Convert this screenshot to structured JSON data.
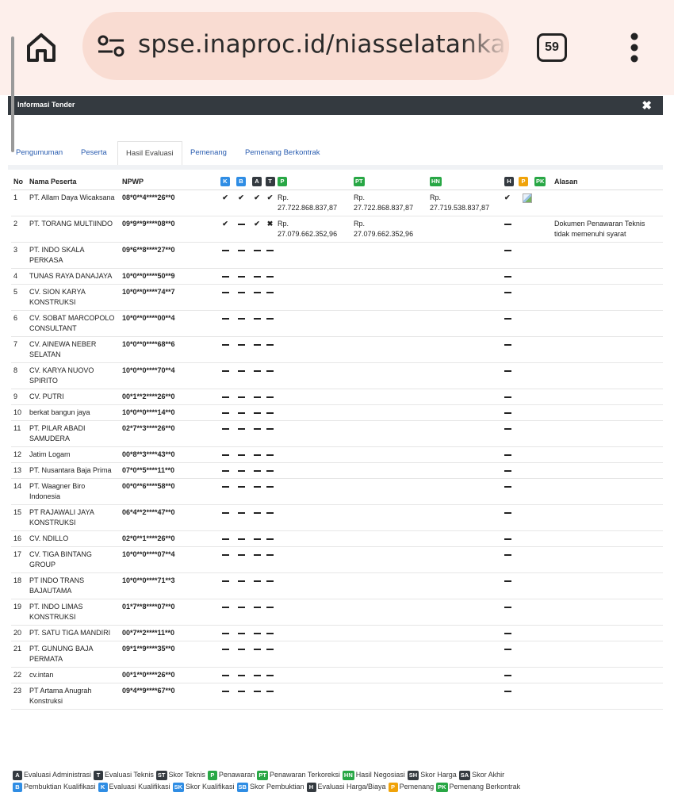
{
  "browser": {
    "url": "spse.inaproc.id/niasselatanka",
    "tab_count": "59"
  },
  "modal": {
    "title": "Informasi Tender",
    "close_label": "✖"
  },
  "tabs": [
    {
      "label": "Pengumuman",
      "active": false
    },
    {
      "label": "Peserta",
      "active": false
    },
    {
      "label": "Hasil Evaluasi",
      "active": true
    },
    {
      "label": "Pemenang",
      "active": false
    },
    {
      "label": "Pemenang Berkontrak",
      "active": false
    }
  ],
  "table": {
    "headers": {
      "no": "No",
      "name": "Nama Peserta",
      "npwp": "NPWP",
      "k": "K",
      "b": "B",
      "a": "A",
      "t": "T",
      "p": "P",
      "pt": "PT",
      "hn": "HN",
      "h": "H",
      "p2": "P",
      "pk": "PK",
      "alasan": "Alasan"
    },
    "rows": [
      {
        "no": "1",
        "name": "PT. Allam Daya Wicaksana",
        "npwp": "08*0**4****26**0",
        "k": "check",
        "b": "check",
        "a": "check",
        "t": "check",
        "p": "Rp. 27.722.868.837,87",
        "pt": "Rp. 27.722.868.837,87",
        "hn": "Rp. 27.719.538.837,87",
        "h": "check",
        "p2": "img",
        "pk": "",
        "alasan": ""
      },
      {
        "no": "2",
        "name": "PT. TORANG MULTIINDO",
        "npwp": "09*9**9****08**0",
        "k": "check",
        "b": "dash",
        "a": "check",
        "t": "cross",
        "p": "Rp. 27.079.662.352,96",
        "pt": "Rp. 27.079.662.352,96",
        "hn": "",
        "h": "dash",
        "p2": "",
        "pk": "",
        "alasan": "Dokumen Penawaran Teknis tidak memenuhi syarat"
      },
      {
        "no": "3",
        "name": "PT. INDO SKALA PERKASA",
        "npwp": "09*6**8****27**0",
        "k": "dash",
        "b": "dash",
        "a": "dash",
        "t": "dash",
        "p": "",
        "pt": "",
        "hn": "",
        "h": "dash",
        "p2": "",
        "pk": "",
        "alasan": ""
      },
      {
        "no": "4",
        "name": "TUNAS RAYA DANAJAYA",
        "npwp": "10*0**0****50**9",
        "k": "dash",
        "b": "dash",
        "a": "dash",
        "t": "dash",
        "p": "",
        "pt": "",
        "hn": "",
        "h": "dash",
        "p2": "",
        "pk": "",
        "alasan": ""
      },
      {
        "no": "5",
        "name": "CV. SION KARYA KONSTRUKSI",
        "npwp": "10*0**0****74**7",
        "k": "dash",
        "b": "dash",
        "a": "dash",
        "t": "dash",
        "p": "",
        "pt": "",
        "hn": "",
        "h": "dash",
        "p2": "",
        "pk": "",
        "alasan": ""
      },
      {
        "no": "6",
        "name": "CV. SOBAT MARCOPOLO CONSULTANT",
        "npwp": "10*0**0****00**4",
        "k": "dash",
        "b": "dash",
        "a": "dash",
        "t": "dash",
        "p": "",
        "pt": "",
        "hn": "",
        "h": "dash",
        "p2": "",
        "pk": "",
        "alasan": ""
      },
      {
        "no": "7",
        "name": "CV. AINEWA NEBER SELATAN",
        "npwp": "10*0**0****68**6",
        "k": "dash",
        "b": "dash",
        "a": "dash",
        "t": "dash",
        "p": "",
        "pt": "",
        "hn": "",
        "h": "dash",
        "p2": "",
        "pk": "",
        "alasan": ""
      },
      {
        "no": "8",
        "name": "CV. KARYA NUOVO SPIRITO",
        "npwp": "10*0**0****70**4",
        "k": "dash",
        "b": "dash",
        "a": "dash",
        "t": "dash",
        "p": "",
        "pt": "",
        "hn": "",
        "h": "dash",
        "p2": "",
        "pk": "",
        "alasan": ""
      },
      {
        "no": "9",
        "name": "CV. PUTRI",
        "npwp": "00*1**2****26**0",
        "k": "dash",
        "b": "dash",
        "a": "dash",
        "t": "dash",
        "p": "",
        "pt": "",
        "hn": "",
        "h": "dash",
        "p2": "",
        "pk": "",
        "alasan": ""
      },
      {
        "no": "10",
        "name": "berkat bangun jaya",
        "npwp": "10*0**0****14**0",
        "k": "dash",
        "b": "dash",
        "a": "dash",
        "t": "dash",
        "p": "",
        "pt": "",
        "hn": "",
        "h": "dash",
        "p2": "",
        "pk": "",
        "alasan": ""
      },
      {
        "no": "11",
        "name": "PT. PILAR ABADI SAMUDERA",
        "npwp": "02*7**3****26**0",
        "k": "dash",
        "b": "dash",
        "a": "dash",
        "t": "dash",
        "p": "",
        "pt": "",
        "hn": "",
        "h": "dash",
        "p2": "",
        "pk": "",
        "alasan": ""
      },
      {
        "no": "12",
        "name": "Jatim Logam",
        "npwp": "00*8**3****43**0",
        "k": "dash",
        "b": "dash",
        "a": "dash",
        "t": "dash",
        "p": "",
        "pt": "",
        "hn": "",
        "h": "dash",
        "p2": "",
        "pk": "",
        "alasan": ""
      },
      {
        "no": "13",
        "name": "PT. Nusantara Baja Prima",
        "npwp": "07*0**5****11**0",
        "k": "dash",
        "b": "dash",
        "a": "dash",
        "t": "dash",
        "p": "",
        "pt": "",
        "hn": "",
        "h": "dash",
        "p2": "",
        "pk": "",
        "alasan": ""
      },
      {
        "no": "14",
        "name": "PT. Waagner Biro Indonesia",
        "npwp": "00*0**6****58**0",
        "k": "dash",
        "b": "dash",
        "a": "dash",
        "t": "dash",
        "p": "",
        "pt": "",
        "hn": "",
        "h": "dash",
        "p2": "",
        "pk": "",
        "alasan": ""
      },
      {
        "no": "15",
        "name": "PT RAJAWALI JAYA KONSTRUKSI",
        "npwp": "06*4**2****47**0",
        "k": "dash",
        "b": "dash",
        "a": "dash",
        "t": "dash",
        "p": "",
        "pt": "",
        "hn": "",
        "h": "dash",
        "p2": "",
        "pk": "",
        "alasan": ""
      },
      {
        "no": "16",
        "name": "CV. NDILLO",
        "npwp": "02*0**1****26**0",
        "k": "dash",
        "b": "dash",
        "a": "dash",
        "t": "dash",
        "p": "",
        "pt": "",
        "hn": "",
        "h": "dash",
        "p2": "",
        "pk": "",
        "alasan": ""
      },
      {
        "no": "17",
        "name": "CV. TIGA BINTANG GROUP",
        "npwp": "10*0**0****07**4",
        "k": "dash",
        "b": "dash",
        "a": "dash",
        "t": "dash",
        "p": "",
        "pt": "",
        "hn": "",
        "h": "dash",
        "p2": "",
        "pk": "",
        "alasan": ""
      },
      {
        "no": "18",
        "name": "PT INDO TRANS BAJAUTAMA",
        "npwp": "10*0**0****71**3",
        "k": "dash",
        "b": "dash",
        "a": "dash",
        "t": "dash",
        "p": "",
        "pt": "",
        "hn": "",
        "h": "dash",
        "p2": "",
        "pk": "",
        "alasan": ""
      },
      {
        "no": "19",
        "name": "PT. INDO LIMAS KONSTRUKSI",
        "npwp": "01*7**8****07**0",
        "k": "dash",
        "b": "dash",
        "a": "dash",
        "t": "dash",
        "p": "",
        "pt": "",
        "hn": "",
        "h": "dash",
        "p2": "",
        "pk": "",
        "alasan": ""
      },
      {
        "no": "20",
        "name": "PT. SATU TIGA MANDIRI",
        "npwp": "00*7**2****11**0",
        "k": "dash",
        "b": "dash",
        "a": "dash",
        "t": "dash",
        "p": "",
        "pt": "",
        "hn": "",
        "h": "dash",
        "p2": "",
        "pk": "",
        "alasan": ""
      },
      {
        "no": "21",
        "name": "PT. GUNUNG BAJA PERMATA",
        "npwp": "09*1**9****35**0",
        "k": "dash",
        "b": "dash",
        "a": "dash",
        "t": "dash",
        "p": "",
        "pt": "",
        "hn": "",
        "h": "dash",
        "p2": "",
        "pk": "",
        "alasan": ""
      },
      {
        "no": "22",
        "name": "cv.intan",
        "npwp": "00*1**0****26**0",
        "k": "dash",
        "b": "dash",
        "a": "dash",
        "t": "dash",
        "p": "",
        "pt": "",
        "hn": "",
        "h": "dash",
        "p2": "",
        "pk": "",
        "alasan": ""
      },
      {
        "no": "23",
        "name": "PT Artama Anugrah Konstruksi",
        "npwp": "09*4**9****67**0",
        "k": "dash",
        "b": "dash",
        "a": "dash",
        "t": "dash",
        "p": "",
        "pt": "",
        "hn": "",
        "h": "dash",
        "p2": "",
        "pk": "",
        "alasan": ""
      }
    ]
  },
  "legend": {
    "row1": [
      {
        "code": "A",
        "label": "Evaluasi Administrasi",
        "color": "#343a40"
      },
      {
        "code": "T",
        "label": "Evaluasi Teknis",
        "color": "#343a40"
      },
      {
        "code": "ST",
        "label": "Skor Teknis",
        "color": "#343a40"
      },
      {
        "code": "P",
        "label": "Penawaran",
        "color": "#28a745"
      },
      {
        "code": "PT",
        "label": "Penawaran Terkoreksi",
        "color": "#28a745"
      },
      {
        "code": "HN",
        "label": "Hasil Negosiasi",
        "color": "#28a745"
      },
      {
        "code": "SH",
        "label": "Skor Harga",
        "color": "#343a40"
      },
      {
        "code": "SA",
        "label": "Skor Akhir",
        "color": "#343a40"
      }
    ],
    "row2": [
      {
        "code": "B",
        "label": "Pembuktian Kualifikasi",
        "color": "#2f8de4"
      },
      {
        "code": "K",
        "label": "Evaluasi Kualifikasi",
        "color": "#2f8de4"
      },
      {
        "code": "SK",
        "label": "Skor Kualifikasi",
        "color": "#2f8de4"
      },
      {
        "code": "SB",
        "label": "Skor Pembuktian",
        "color": "#2f8de4"
      },
      {
        "code": "H",
        "label": "Evaluasi Harga/Biaya",
        "color": "#343a40"
      },
      {
        "code": "P",
        "label": "Pemenang",
        "color": "#f0a30a"
      },
      {
        "code": "PK",
        "label": "Pemenang Berkontrak",
        "color": "#28a745"
      }
    ]
  },
  "colors": {
    "header_bg": "#343a40",
    "link": "#2a5db0",
    "chrome_bg": "#fdefeb",
    "url_pill": "#f9dcd2"
  }
}
